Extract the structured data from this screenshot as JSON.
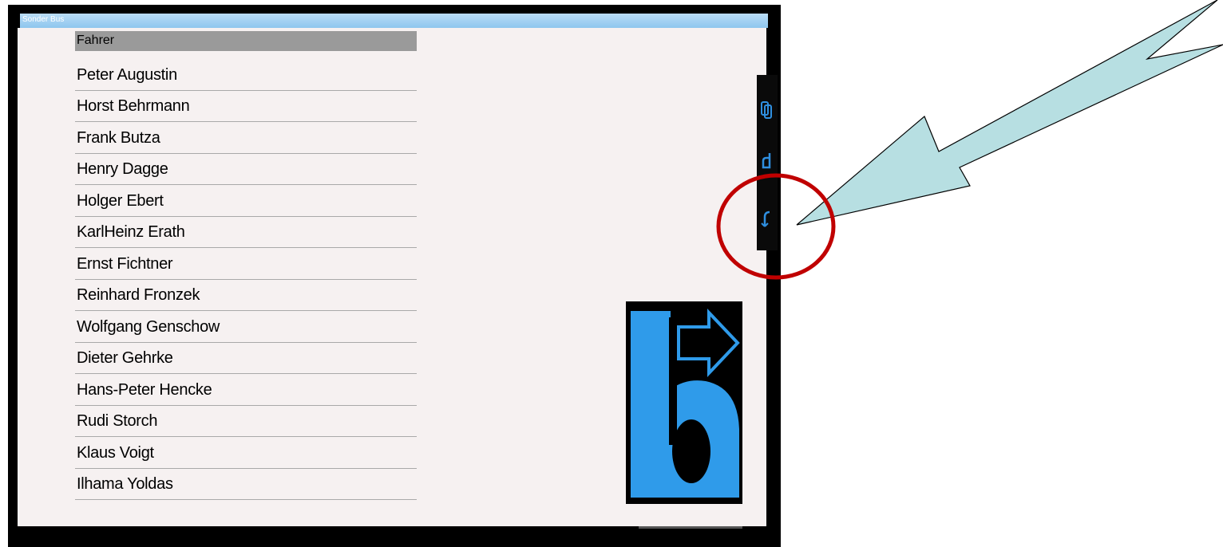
{
  "window": {
    "title": "Sonder Bus"
  },
  "list": {
    "header": "Fahrer",
    "items": [
      {
        "label": "Peter Augustin"
      },
      {
        "label": "Horst Behrmann"
      },
      {
        "label": "Frank Butza"
      },
      {
        "label": "Henry Dagge"
      },
      {
        "label": "Holger Ebert"
      },
      {
        "label": "KarlHeinz Erath"
      },
      {
        "label": "Ernst Fichtner"
      },
      {
        "label": "Reinhard Fronzek"
      },
      {
        "label": "Wolfgang Genschow"
      },
      {
        "label": "Dieter Gehrke"
      },
      {
        "label": "Hans-Peter Hencke"
      },
      {
        "label": "Rudi Storch"
      },
      {
        "label": "Klaus Voigt"
      },
      {
        "label": "Ilhama Yoldas"
      }
    ]
  },
  "side_icons": [
    "copy-icon",
    "hook-icon",
    "return-icon"
  ],
  "logo": {
    "icon": "b-arrow-logo"
  },
  "colors": {
    "accent": "#2f8fe0",
    "callout_fill": "#b7dfe2",
    "circle": "#c00000"
  }
}
